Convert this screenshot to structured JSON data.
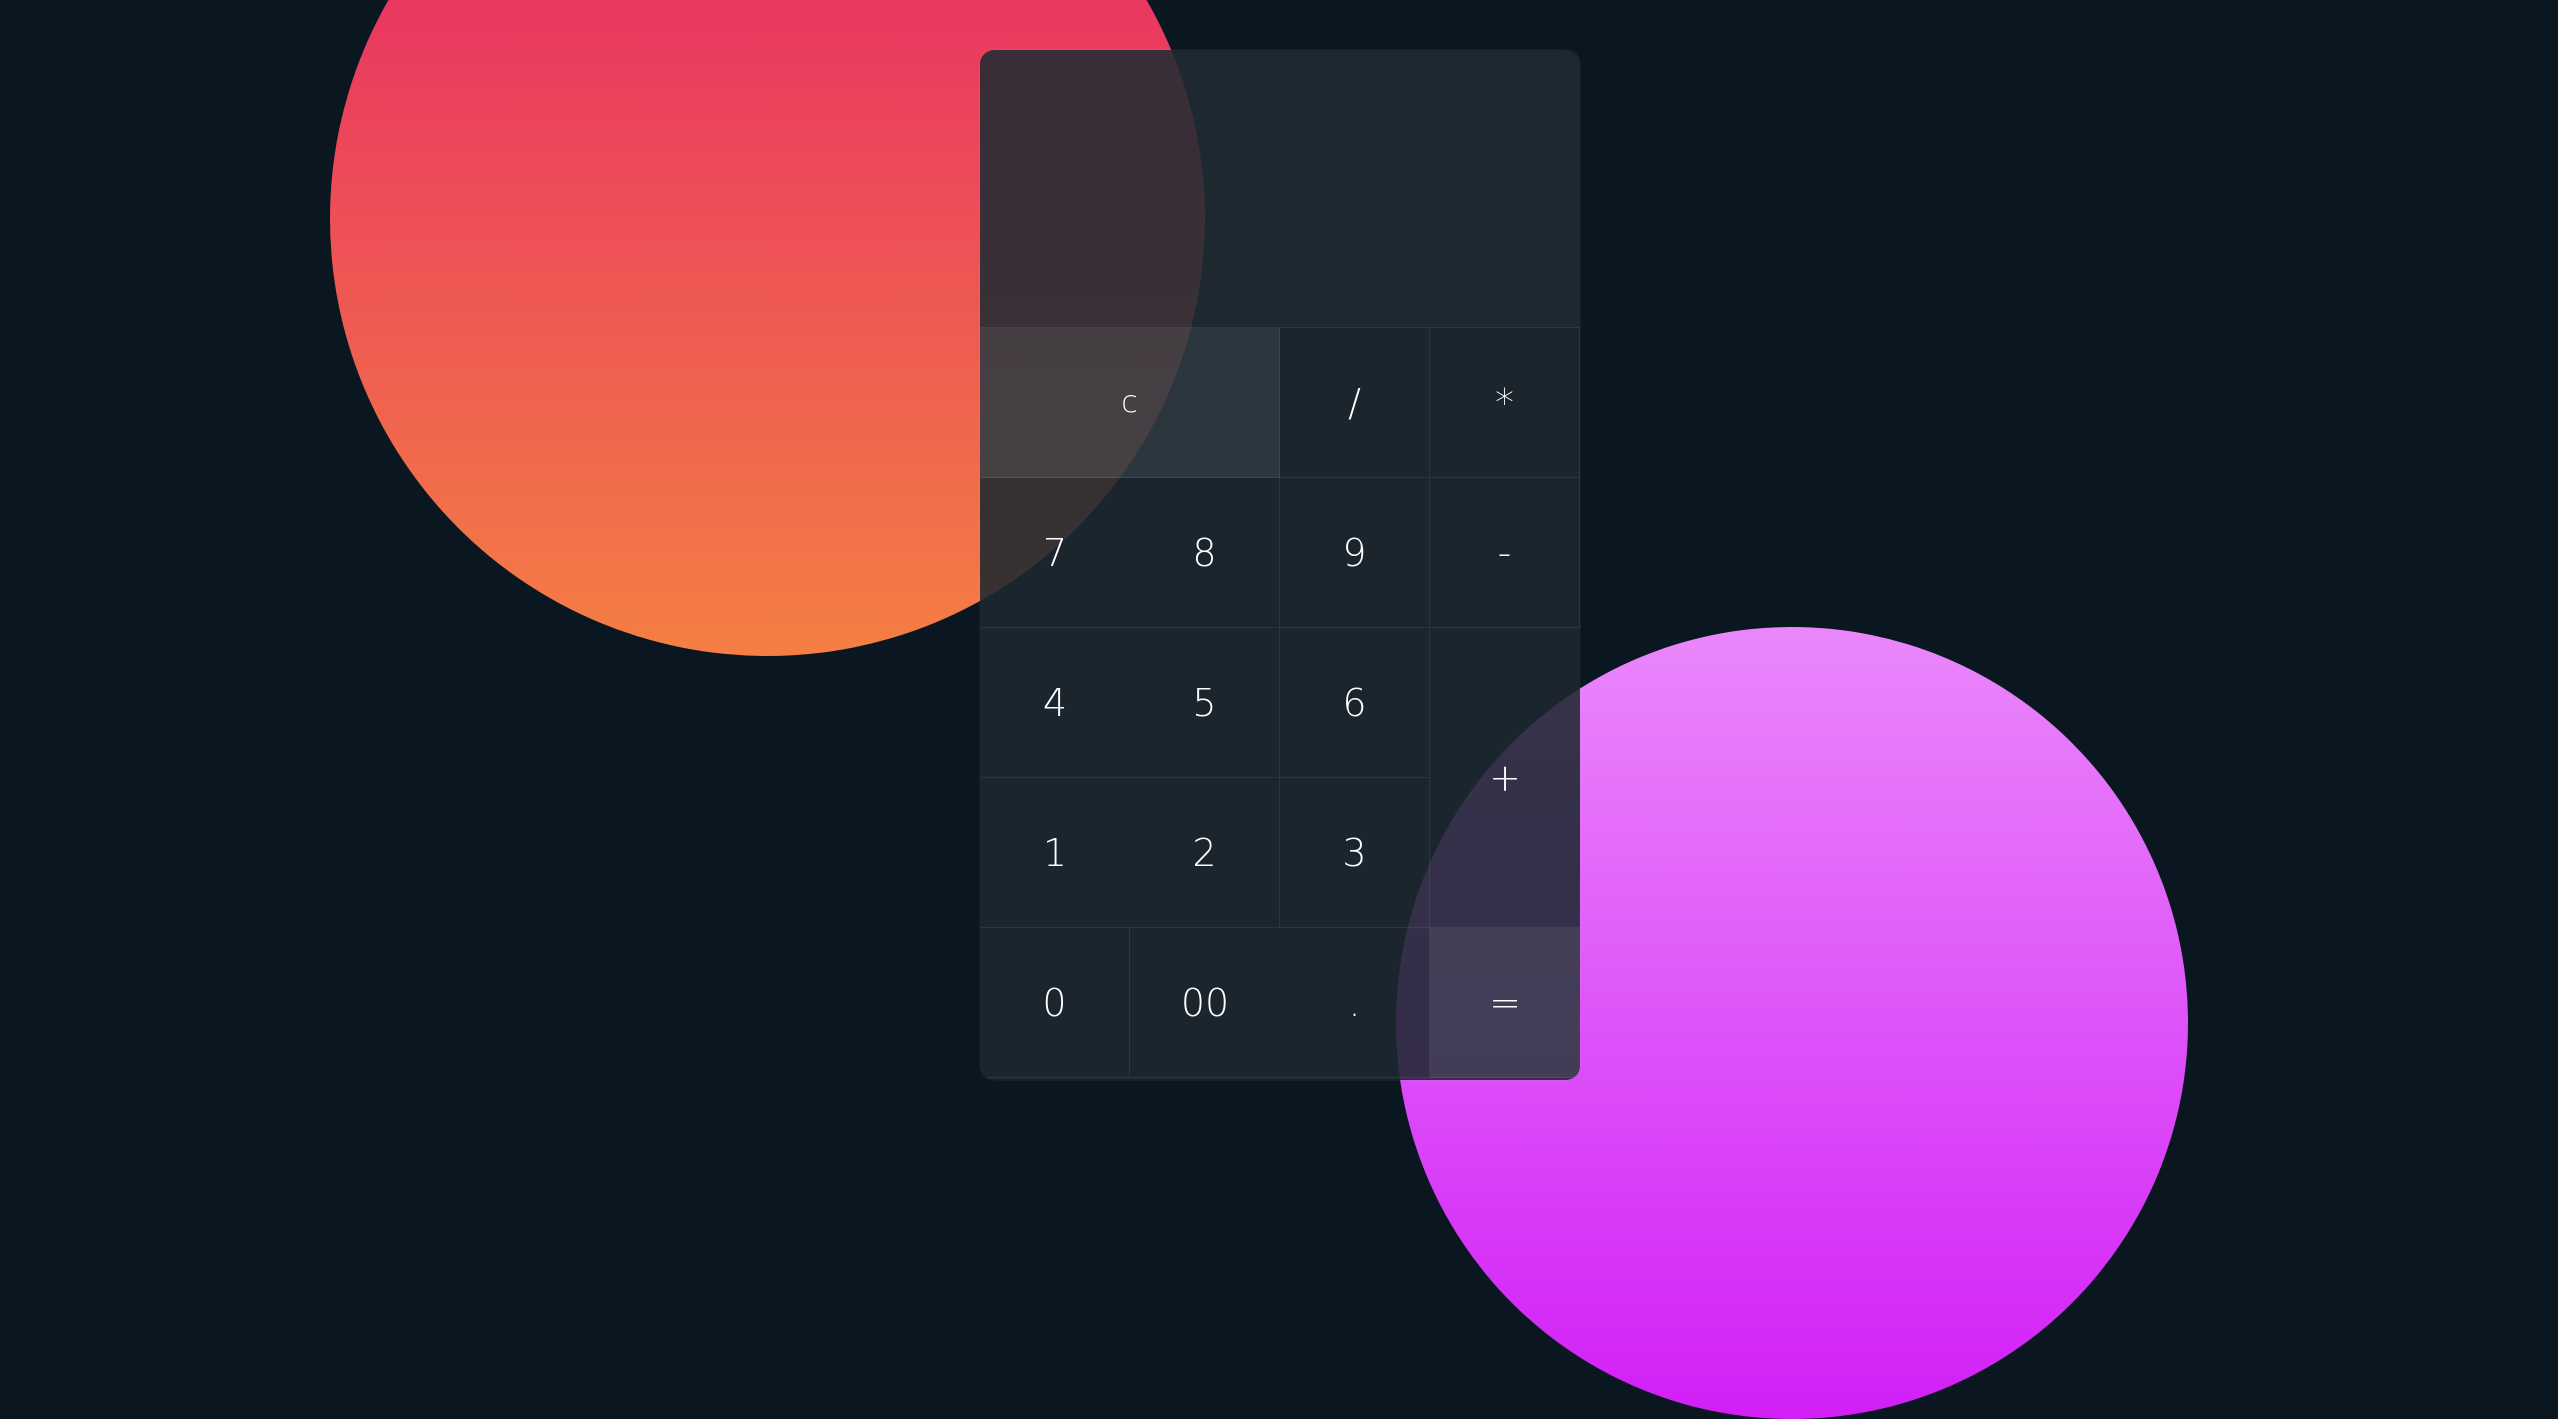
{
  "background": {
    "color": "#0b1720",
    "circle_top_gradient": [
      "#e61f6b",
      "#f47f43"
    ],
    "circle_bottom_gradient": [
      "#ea88fb",
      "#d21ff7"
    ]
  },
  "calculator": {
    "display_value": "",
    "keys": {
      "clear": "c",
      "divide": "/",
      "multiply": "*",
      "seven": "7",
      "eight": "8",
      "nine": "9",
      "subtract": "-",
      "four": "4",
      "five": "5",
      "six": "6",
      "add": "+",
      "one": "1",
      "two": "2",
      "three": "3",
      "zero": "0",
      "double_zero": "00",
      "decimal": ".",
      "equals": "="
    }
  }
}
